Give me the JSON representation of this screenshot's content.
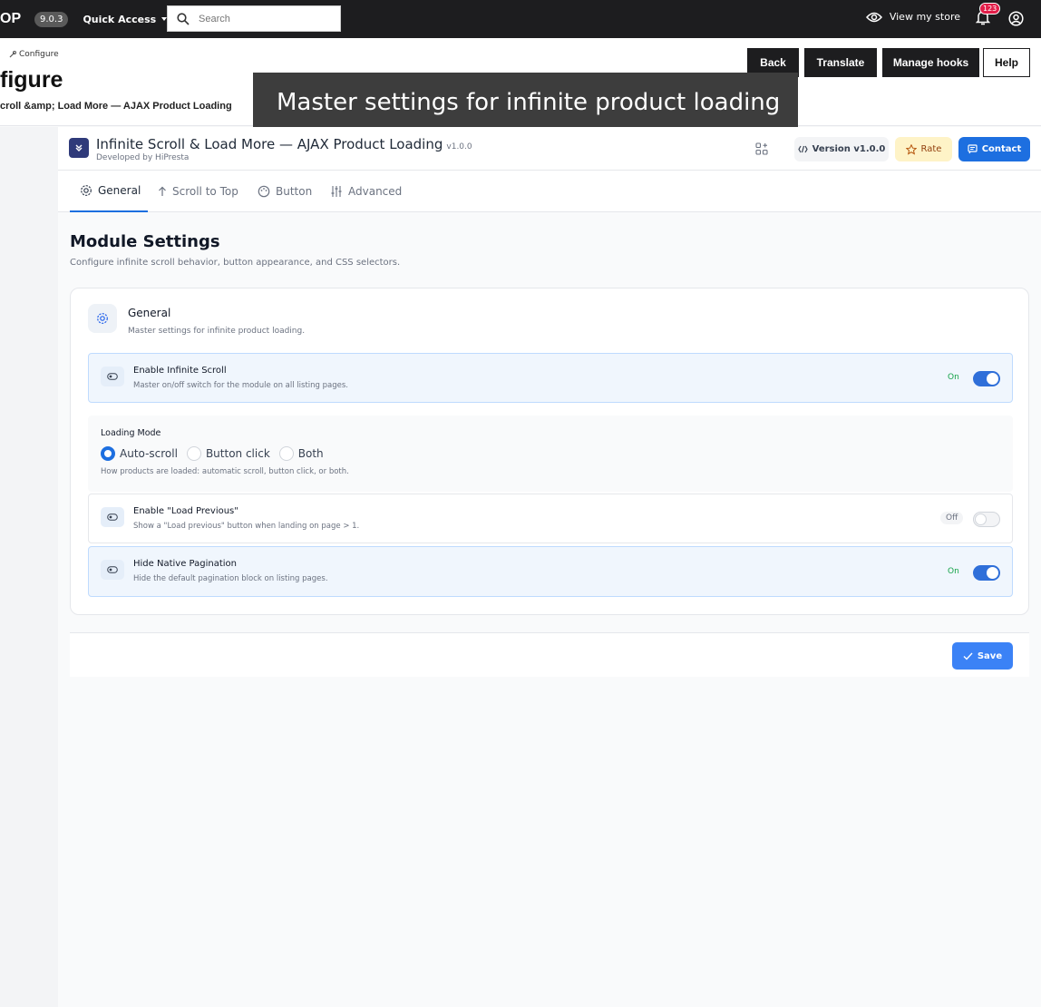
{
  "topbar": {
    "logo_text": "OP",
    "version": "9.0.3",
    "quick_access": "Quick Access",
    "search_placeholder": "Search",
    "view_store": "View my store",
    "notification_count": "123"
  },
  "header": {
    "breadcrumb": "Configure",
    "title": "figure",
    "subtitle": "croll &amp; Load More — AJAX Product Loading",
    "buttons": {
      "back": "Back",
      "translate": "Translate",
      "manage_hooks": "Manage hooks",
      "help": "Help"
    },
    "tooltip": "Master settings for infinite product loading"
  },
  "module": {
    "name": "Infinite Scroll & Load More — AJAX Product Loading",
    "version_small": "v1.0.0",
    "developer": "Developed by HiPresta",
    "version_button": "Version v1.0.0",
    "rate_button": "Rate",
    "contact_button": "Contact",
    "tabs": [
      "General",
      "Scroll to Top",
      "Button",
      "Advanced"
    ],
    "section_title": "Module Settings",
    "section_desc": "Configure infinite scroll behavior, button appearance, and CSS selectors.",
    "card": {
      "title": "General",
      "desc": "Master settings for infinite product loading.",
      "enable_infinite": {
        "title": "Enable Infinite Scroll",
        "desc": "Master on/off switch for the module on all listing pages.",
        "state": "On"
      },
      "loading_mode": {
        "label": "Loading Mode",
        "options": [
          "Auto-scroll",
          "Button click",
          "Both"
        ],
        "selected": "Auto-scroll",
        "desc": "How products are loaded: automatic scroll, button click, or both."
      },
      "load_previous": {
        "title": "Enable \"Load Previous\"",
        "desc": "Show a \"Load previous\" button when landing on page > 1.",
        "state": "Off"
      },
      "hide_pagination": {
        "title": "Hide Native Pagination",
        "desc": "Hide the default pagination block on listing pages.",
        "state": "On"
      }
    },
    "save": "Save"
  },
  "colors": {
    "accent": "#1d6fe0",
    "on_text": "#16a34a",
    "dark": "#1d1d1f"
  }
}
